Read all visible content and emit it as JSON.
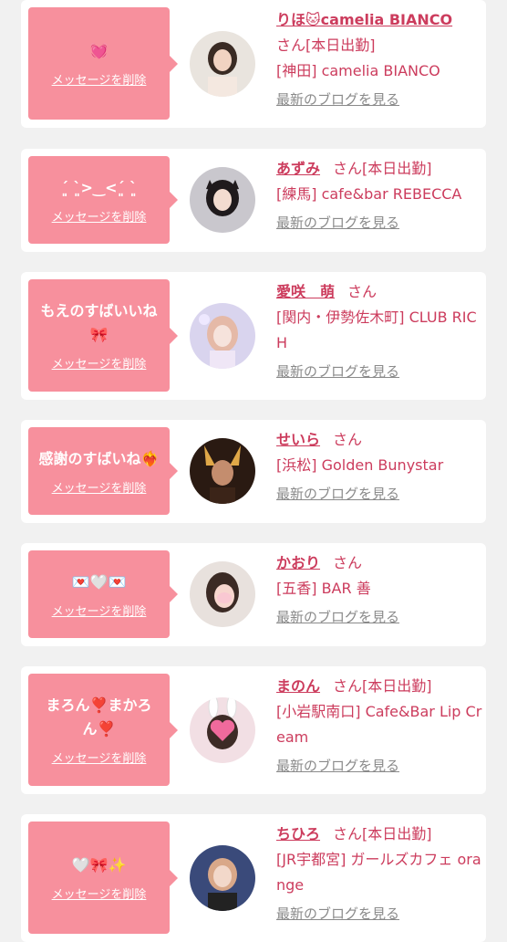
{
  "delete_label": "メッセージを削除",
  "blog_label": "最新のブログを見る",
  "san_label": "さん",
  "cards": [
    {
      "message": "💓",
      "name": "りほ🐱camelia BIANCO",
      "status": "[本日出勤]",
      "shop": "[神田] camelia BIANCO"
    },
    {
      "message": "ˊ͈ ˋ͈>‿<ˊ͈ ˋ͈",
      "name": "あずみ",
      "status": "[本日出勤]",
      "shop": "[練馬] cafe&bar REBECCA"
    },
    {
      "message": "もえのすばいいね🎀",
      "name": "愛咲　萌",
      "status": "",
      "shop": "[関内・伊勢佐木町] CLUB RICH"
    },
    {
      "message": "感謝のすばいね❤️‍🔥",
      "name": "せいら",
      "status": "",
      "shop": "[浜松] Golden Bunystar"
    },
    {
      "message": "💌🤍💌",
      "name": "かおり",
      "status": "",
      "shop": "[五香] BAR 善"
    },
    {
      "message": "まろん❣️まかろん❣️",
      "name": "まのん",
      "status": "[本日出勤]",
      "shop": "[小岩駅南口] Cafe&Bar Lip Cream"
    },
    {
      "message": "🤍🎀✨",
      "name": "ちひろ",
      "status": "[本日出勤]",
      "shop": "[JR宇都宮] ガールズカフェ orange"
    }
  ],
  "colors": {
    "accent": "#cc3c5d",
    "bubble": "#f7909d",
    "link_gray": "#8a8a8a"
  }
}
